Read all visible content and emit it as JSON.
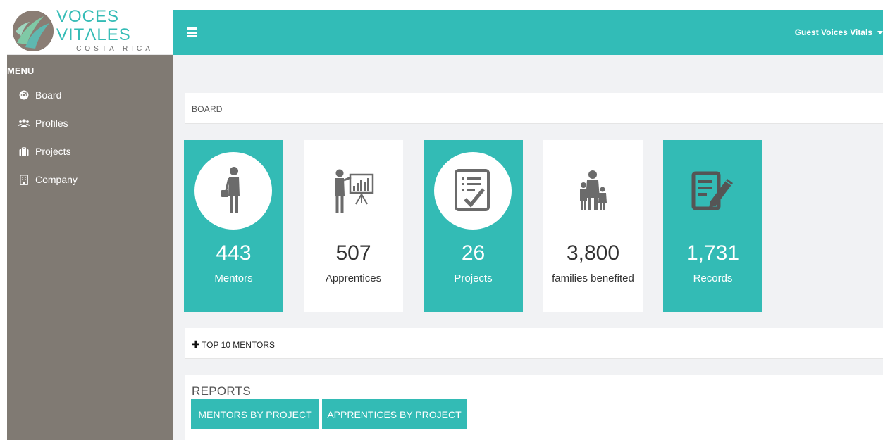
{
  "brand": {
    "name": "VOCES VITΛLES",
    "subtitle": "COSTA RICA"
  },
  "menu": {
    "heading": "MENU",
    "items": [
      {
        "label": "Board",
        "icon": "dashboard-icon"
      },
      {
        "label": "Profiles",
        "icon": "users-icon"
      },
      {
        "label": "Projects",
        "icon": "briefcase-icon"
      },
      {
        "label": "Company",
        "icon": "building-icon"
      }
    ]
  },
  "topbar": {
    "user": "Guest Voices Vitals"
  },
  "board": {
    "title": "BOARD"
  },
  "stats": [
    {
      "value": "443",
      "label": "Mentors",
      "icon": "mentor-person-icon",
      "style": "teal"
    },
    {
      "value": "507",
      "label": "Apprentices",
      "icon": "presenter-board-icon",
      "style": "white"
    },
    {
      "value": "26",
      "label": "Projects",
      "icon": "checklist-icon",
      "style": "teal"
    },
    {
      "value": "3,800",
      "label": "families benefited",
      "icon": "family-icon",
      "style": "white"
    },
    {
      "value": "1,731",
      "label": "Records",
      "icon": "edit-document-icon",
      "style": "teal"
    }
  ],
  "top_mentors": {
    "label": "TOP 10 MENTORS"
  },
  "reports": {
    "title": "REPORTS",
    "buttons": [
      "MENTORS BY PROJECT",
      "APPRENTICES BY PROJECT"
    ]
  },
  "colors": {
    "accent": "#32bcb7",
    "sidebar": "#807a73",
    "content_bg": "#f1f2f4"
  }
}
